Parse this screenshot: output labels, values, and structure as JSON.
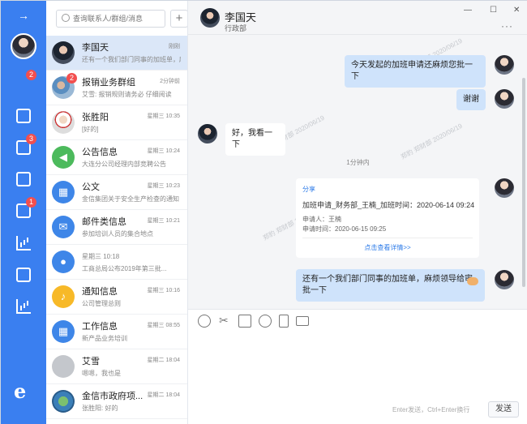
{
  "rail": {
    "badges": {
      "chat": "2",
      "tasks": "3",
      "docs": "1"
    }
  },
  "search": {
    "placeholder": "查询联系人/群组/消息"
  },
  "contacts": [
    {
      "name": "李国天",
      "time": "刚刚",
      "preview": "还有一个我们部门同事的加班单，麻烦领导给审批一下"
    },
    {
      "name": "报销业务群组",
      "time": "2分钟前",
      "preview": "艾雪: 报销规则请务必 仔细阅读",
      "badge": "2"
    },
    {
      "name": "张胜阳",
      "time": "星期三 10:35",
      "preview": "[好的]"
    },
    {
      "name": "公告信息",
      "time": "星期三 10:24",
      "preview": "大连分公司经理内部竞聘公告"
    },
    {
      "name": "公文",
      "time": "星期三 10:23",
      "preview": "金信集团关于安全生产检查的通知"
    },
    {
      "name": "邮件类信息",
      "time": "星期三 10:21",
      "preview": "参加培训人员的集合地点"
    },
    {
      "name": "星期三 10:18",
      "time": "",
      "preview": "工商总局公布2019年第三批..."
    },
    {
      "name": "通知信息",
      "time": "星期三 10:16",
      "preview": "公司管理总则"
    },
    {
      "name": "工作信息",
      "time": "星期三 08:55",
      "preview": "新产品业务培训"
    },
    {
      "name": "艾雪",
      "time": "星期二 18:04",
      "preview": "嗯嗯，我也是"
    },
    {
      "name": "金信市政府项...",
      "time": "星期二 18:04",
      "preview": "张胜阳: 好的"
    }
  ],
  "chat": {
    "name": "李国天",
    "dept": "行政部",
    "messages": {
      "m1": "今天发起的加班申请还麻烦您批一下",
      "m2": "谢谢",
      "m3": "好，我看一下",
      "divider": "1分钟内",
      "m5": "还有一个我们部门同事的加班单，麻烦领导给审批一下"
    },
    "card": {
      "tag": "分享",
      "title": "加班申请_财务部_王楠_加班时间：2020-06-14 09:24...",
      "applicant": "申请人：王楠",
      "date": "申请时间：2020-06-15 09:25",
      "link": "点击查看详情>>"
    },
    "watermark": "郑豹 郑财部 2020/06/19"
  },
  "window_controls": {
    "minimize": "—",
    "maximize": "☐",
    "close": "✕",
    "more": "···"
  },
  "composer": {
    "hint": "Enter发送，Ctrl+Enter换行",
    "send": "发送"
  },
  "rail_arrow": "→",
  "add_symbol": "+",
  "ie_symbol": "e"
}
